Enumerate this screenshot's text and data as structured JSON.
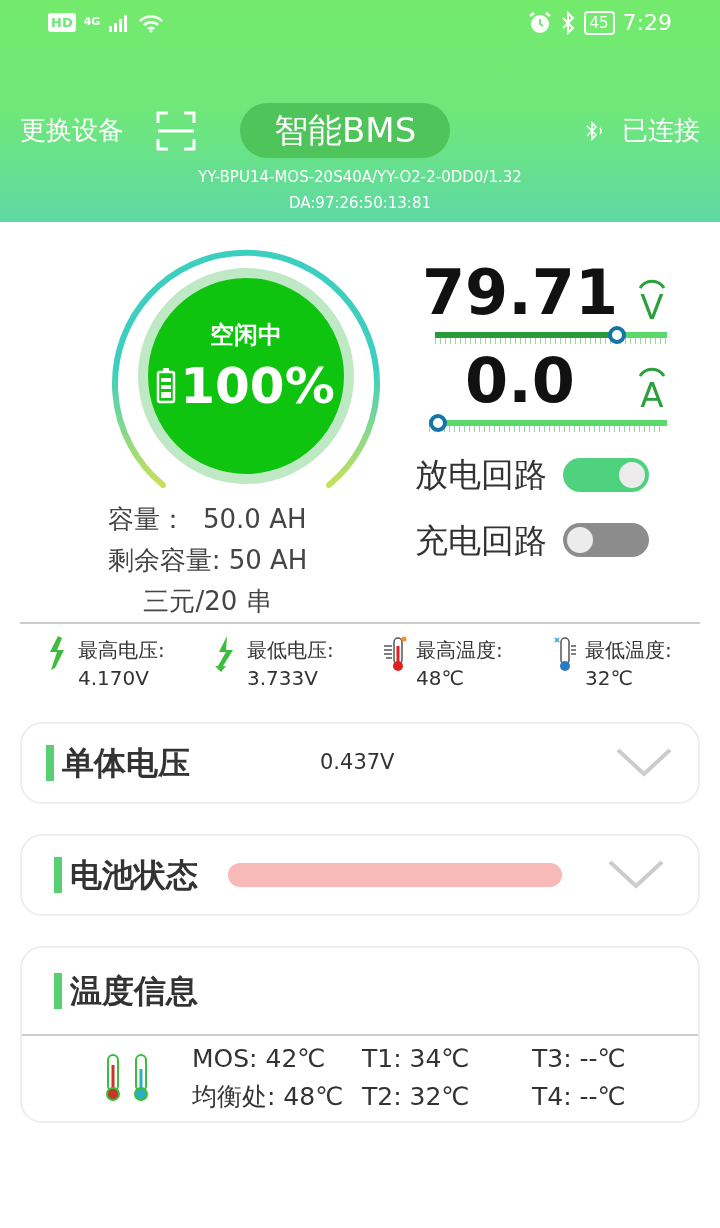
{
  "status_bar": {
    "hd": "HD",
    "network": "4G",
    "battery": "45",
    "time": "7:29"
  },
  "header": {
    "switch_device": "更换设备",
    "title": "智能BMS",
    "connection": "已连接",
    "device_info": [
      "YY-BPU14-MOS-20S40A/YY-O2-2-0DD0/1.32",
      "DA:97:26:50:13:81"
    ]
  },
  "gauge": {
    "status": "空闲中",
    "percent": "100%",
    "details": [
      "容量：  50.0 AH",
      "剩余容量: 50 AH",
      "三元/20 串"
    ]
  },
  "meters": [
    {
      "value": "79.71",
      "unit": "V",
      "level": 0.81
    },
    {
      "value": "0.0",
      "unit": "A",
      "level": 0.0
    }
  ],
  "switches": [
    {
      "label": "放电回路",
      "on": true
    },
    {
      "label": "充电回路",
      "on": false
    }
  ],
  "stats": [
    {
      "kind": "bolt-up",
      "label": "最高电压:",
      "value": "4.170V"
    },
    {
      "kind": "bolt-down",
      "label": "最低电压:",
      "value": "3.733V"
    },
    {
      "kind": "hot",
      "label": "最高温度:",
      "value": "48℃"
    },
    {
      "kind": "cold",
      "label": "最低温度:",
      "value": "32℃"
    }
  ],
  "sections": [
    {
      "kind": "value",
      "title": "单体电压",
      "value": "0.437V",
      "expanded": false
    },
    {
      "kind": "bar",
      "title": "电池状态",
      "expanded": false
    },
    {
      "kind": "temps",
      "title": "温度信息",
      "readings": [
        "MOS: 42℃",
        "T1: 34℃",
        "T3: --℃",
        "均衡处: 48℃",
        "T2: 32℃",
        "T4: --℃"
      ]
    }
  ]
}
